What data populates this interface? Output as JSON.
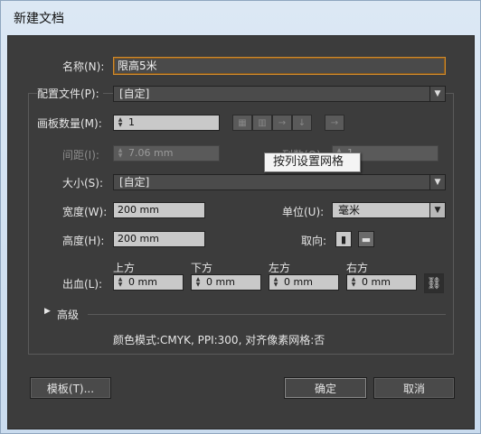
{
  "window": {
    "title": "新建文档"
  },
  "name": {
    "label": "名称(N):",
    "value": "限高5米"
  },
  "profile": {
    "label": "配置文件(P):",
    "value": "[自定]"
  },
  "artboards": {
    "label": "画板数量(M):",
    "value": "1"
  },
  "spacing": {
    "label": "间距(I):",
    "value": "7.06 mm"
  },
  "columns": {
    "label": "列数(O):",
    "value": "1"
  },
  "tooltip": {
    "text": "按列设置网格"
  },
  "size": {
    "label": "大小(S):",
    "value": "[自定]"
  },
  "width": {
    "label": "宽度(W):",
    "value": "200 mm"
  },
  "height": {
    "label": "高度(H):",
    "value": "200 mm"
  },
  "units": {
    "label": "单位(U):",
    "value": "毫米"
  },
  "orientation": {
    "label": "取向:"
  },
  "bleed": {
    "label": "出血(L):",
    "top_label": "上方",
    "top": "0 mm",
    "bottom_label": "下方",
    "bottom": "0 mm",
    "left_label": "左方",
    "left": "0 mm",
    "right_label": "右方",
    "right": "0 mm"
  },
  "advanced": {
    "label": "高级"
  },
  "info": {
    "text": "颜色模式:CMYK, PPI:300, 对齐像素网格:否"
  },
  "buttons": {
    "templates": "模板(T)...",
    "ok": "确定",
    "cancel": "取消"
  },
  "colors": {
    "accent": "#d08b2d",
    "panel": "#3c3c3c",
    "chrome": "#c9dbee"
  }
}
